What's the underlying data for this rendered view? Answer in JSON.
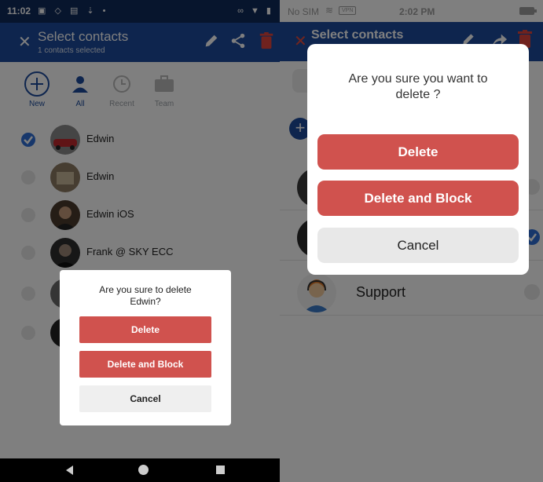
{
  "android": {
    "status_bar": {
      "time": "11:02"
    },
    "header": {
      "title": "Select contacts",
      "subtitle": "1 contacts selected",
      "icons": [
        "close-icon",
        "pencil-icon",
        "share-icon",
        "trash-icon"
      ]
    },
    "tabs": [
      {
        "label": "New",
        "icon": "plus-circle-icon",
        "active": true
      },
      {
        "label": "All",
        "icon": "person-icon",
        "active": true
      },
      {
        "label": "Recent",
        "icon": "clock-icon",
        "active": false
      },
      {
        "label": "Team",
        "icon": "briefcase-icon",
        "active": false
      }
    ],
    "contacts": [
      {
        "name": "Edwin",
        "selected": true
      },
      {
        "name": "Edwin",
        "selected": false
      },
      {
        "name": "Edwin iOS",
        "selected": false
      },
      {
        "name": "Frank @ SKY ECC",
        "selected": false
      }
    ],
    "dialog": {
      "message": "Are you sure to delete Edwin?",
      "delete_label": "Delete",
      "delete_block_label": "Delete and Block",
      "cancel_label": "Cancel"
    }
  },
  "ios": {
    "status_bar": {
      "carrier": "No SIM",
      "vpn": "VPN",
      "time": "2:02 PM"
    },
    "header": {
      "title": "Select contacts",
      "icons": [
        "close-icon",
        "pencil-icon",
        "share-icon",
        "trash-icon"
      ]
    },
    "contacts": [
      {
        "name": "",
        "selected": false
      },
      {
        "name": "",
        "selected": true
      },
      {
        "name": "Support",
        "selected": false
      }
    ],
    "dialog": {
      "message": "Are you sure you want to delete ?",
      "delete_label": "Delete",
      "delete_block_label": "Delete and Block",
      "cancel_label": "Cancel"
    }
  },
  "colors": {
    "header_blue": "#1d4b9c",
    "status_dark": "#0f2a5a",
    "delete_red": "#d0524e",
    "checkbox_blue": "#2f6fd6",
    "cancel_grey": "#efefef"
  }
}
